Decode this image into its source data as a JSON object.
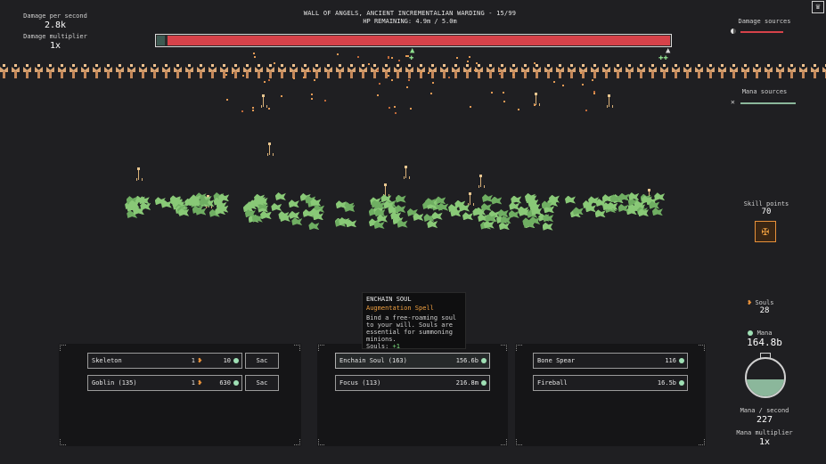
{
  "left_stats": {
    "dps_label": "Damage per second",
    "dps_value": "2.8k",
    "mult_label": "Damage multiplier",
    "mult_value": "1x"
  },
  "boss": {
    "title": "WALL OF ANGELS, ANCIENT INCREMENTALIAN WARDING - 15/99",
    "hp_text": "HP REMAINING: 4.9m / 5.0m",
    "hp_fraction": 0.98,
    "hp_color": "#d6424a"
  },
  "right_panel": {
    "damage_sources_label": "Damage sources",
    "mana_sources_label": "Mana sources",
    "skill_points_label": "Skill points",
    "skill_points_value": "70",
    "souls_label": "Souls",
    "souls_value": "28",
    "mana_label": "Mana",
    "mana_value": "164.8b",
    "mana_fill_fraction": 0.45,
    "mana_per_second_label": "Mana / second",
    "mana_per_second_value": "227",
    "mana_multiplier_label": "Mana multiplier",
    "mana_multiplier_value": "1x",
    "damage_source_color": "#d6424a",
    "mana_source_color": "#8bb79b"
  },
  "tooltip": {
    "title": "ENCHAIN SOUL",
    "subtitle": "Augmentation Spell",
    "description": "Bind a free-roaming soul to your will. Souls are essential for summoning minions.",
    "souls_label": "Souls:",
    "souls_gain": "+1"
  },
  "minions_panel": {
    "rows": [
      {
        "name": "Skeleton",
        "count": "1",
        "cost": "10",
        "sac_label": "Sac"
      },
      {
        "name": "Goblin (135)",
        "count": "1",
        "cost": "630",
        "sac_label": "Sac"
      }
    ]
  },
  "augment_panel": {
    "rows": [
      {
        "name": "Enchain Soul (163)",
        "cost": "156.6b"
      },
      {
        "name": "Focus (113)",
        "cost": "216.8m"
      }
    ]
  },
  "attack_panel": {
    "rows": [
      {
        "name": "Bone Spear",
        "cost": "116"
      },
      {
        "name": "Fireball",
        "cost": "16.5b"
      }
    ]
  },
  "icons": {
    "corner": "crown-icon",
    "skill": "cross-rune-icon",
    "soul": "soul-icon",
    "mana_orb": "mana-orb-icon"
  }
}
